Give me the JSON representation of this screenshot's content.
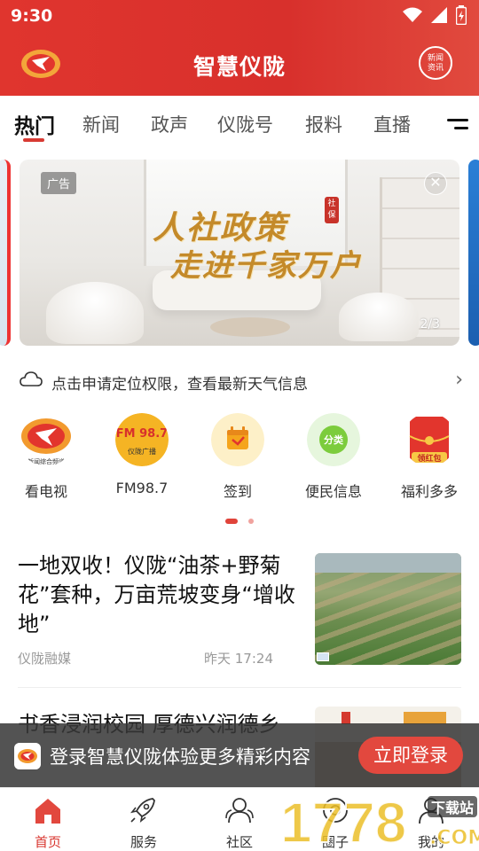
{
  "status": {
    "time": "9:30"
  },
  "header": {
    "title": "智慧仪陇",
    "news_badge_line1": "新闻",
    "news_badge_line2": "资讯"
  },
  "tabs": [
    "热门",
    "新闻",
    "政声",
    "仪陇号",
    "报料",
    "直播"
  ],
  "banner": {
    "ad_label": "广告",
    "headline_line1": "人社政策",
    "headline_line2": "走进千家万户",
    "seal_text": "社保",
    "pager": "2/3"
  },
  "weather": {
    "text": "点击申请定位权限，查看最新天气信息"
  },
  "quick_links": [
    {
      "label": "看电视",
      "icon": "tv-station-icon",
      "sub": "新闻综合频道"
    },
    {
      "label": "FM98.7",
      "icon": "fm-radio-icon",
      "sub": "FM 98.7",
      "sub2": "仪陇广播"
    },
    {
      "label": "签到",
      "icon": "calendar-checkin-icon"
    },
    {
      "label": "便民信息",
      "icon": "classify-icon",
      "sub": "分类"
    },
    {
      "label": "福利多多",
      "icon": "red-envelope-icon",
      "sub": "领红包"
    }
  ],
  "news": [
    {
      "title": "一地双收！仪陇“油茶+野菊花”套种，万亩荒坡变身“增收地”",
      "source": "仪陇融媒",
      "time": "昨天 17:24"
    },
    {
      "title": "书香浸润校园 厚德兴润德乡"
    }
  ],
  "login_prompt": {
    "text": "登录智慧仪陇体验更多精彩内容",
    "button": "立即登录"
  },
  "bottom_nav": [
    "首页",
    "服务",
    "社区",
    "圈子",
    "我的"
  ],
  "watermark": {
    "text": "1778",
    "tag": "下载站",
    "suffix": ".COM"
  },
  "colors": {
    "brand_red": "#d8302c",
    "accent": "#e2483e"
  }
}
